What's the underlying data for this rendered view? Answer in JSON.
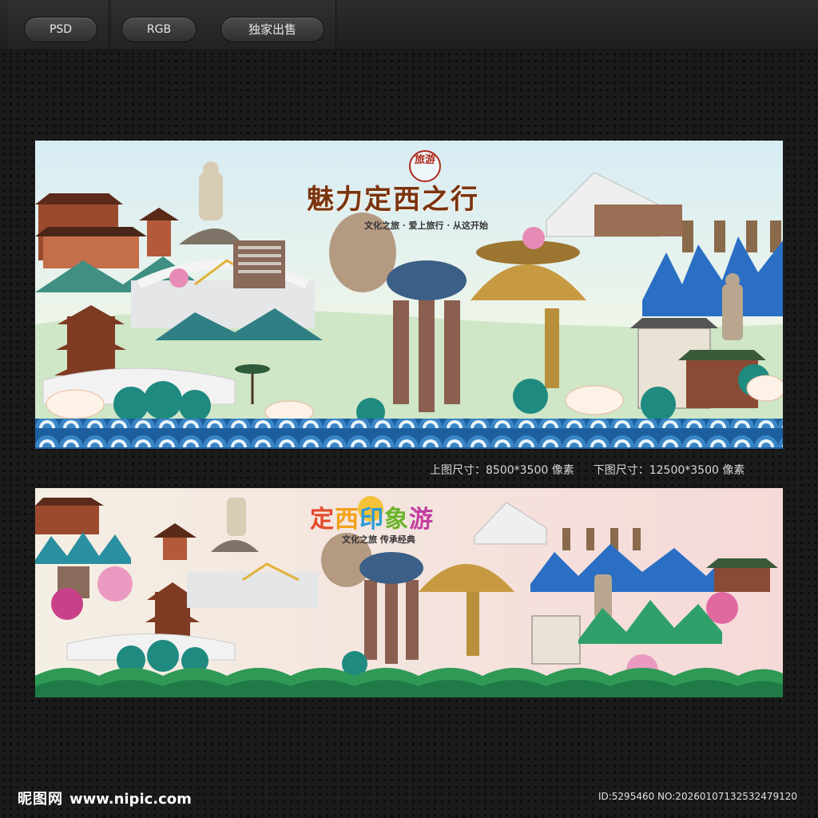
{
  "toolbar": {
    "tabs": [
      {
        "label": "PSD"
      },
      {
        "label": "RGB"
      },
      {
        "label": "独家出售"
      }
    ]
  },
  "posters": {
    "top": {
      "seal_text": "旅游",
      "title": "魅力定西之行",
      "subtitle": "文化之旅 · 爱上旅行 · 从这开始"
    },
    "bottom": {
      "title_chars": [
        "定",
        "西",
        "印",
        "象",
        "游"
      ],
      "subtitle": "文化之旅 传承经典"
    }
  },
  "size_info": {
    "top": "上图尺寸：8500*3500 像素",
    "bottom": "下图尺寸：12500*3500 像素"
  },
  "footer": {
    "logo_zh": "昵图网",
    "logo_url": "www.nipic.com",
    "image_id": "ID:5295460 NO:20260107132532479120"
  },
  "colors": {
    "background": "#1b1b1b",
    "wave_blue": "#2f6fb0",
    "tree_teal": "#1f8a80",
    "title_brown": "#7a3410"
  }
}
